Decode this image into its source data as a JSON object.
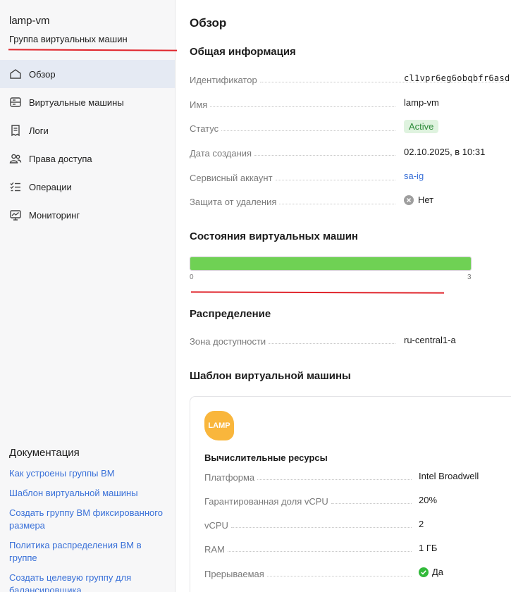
{
  "sidebar": {
    "title": "lamp-vm",
    "subtitle": "Группа виртуальных машин",
    "nav": [
      {
        "label": "Обзор",
        "icon": "overview-icon",
        "active": true
      },
      {
        "label": "Виртуальные машины",
        "icon": "vm-icon"
      },
      {
        "label": "Логи",
        "icon": "logs-icon"
      },
      {
        "label": "Права доступа",
        "icon": "users-icon"
      },
      {
        "label": "Операции",
        "icon": "operations-icon"
      },
      {
        "label": "Мониторинг",
        "icon": "monitoring-icon"
      }
    ],
    "docs": {
      "title": "Документация",
      "links": [
        "Как устроены группы ВМ",
        "Шаблон виртуальной машины",
        "Создать группу ВМ фиксированного размера",
        "Политика распределения ВМ в группе",
        "Создать целевую группу для балансировщика"
      ]
    }
  },
  "main": {
    "title": "Обзор",
    "general": {
      "title": "Общая информация",
      "id_label": "Идентификатор",
      "id_value": "cl1vpr6eg6obqbfr6asd",
      "name_label": "Имя",
      "name_value": "lamp-vm",
      "status_label": "Статус",
      "status_value": "Active",
      "created_label": "Дата создания",
      "created_value": "02.10.2025, в 10:31",
      "sa_label": "Сервисный аккаунт",
      "sa_value": "sa-ig",
      "protect_label": "Защита от удаления",
      "protect_value": "Нет"
    },
    "vm_states": {
      "title": "Состояния виртуальных машин",
      "min": "0",
      "max": "3",
      "fill_fraction": 1.0
    },
    "distribution": {
      "title": "Распределение",
      "zone_label": "Зона доступности",
      "zone_value": "ru-central1-a"
    },
    "template": {
      "title": "Шаблон виртуальной машины",
      "logo_text": "LAMP",
      "compute_title": "Вычислительные ресурсы",
      "platform_label": "Платформа",
      "platform_value": "Intel Broadwell",
      "fraction_label": "Гарантированная доля vCPU",
      "fraction_value": "20%",
      "vcpu_label": "vCPU",
      "vcpu_value": "2",
      "ram_label": "RAM",
      "ram_value": "1 ГБ",
      "preempt_label": "Прерываемая",
      "preempt_value": "Да"
    }
  },
  "colors": {
    "accent": "#3970d8",
    "active_nav": "#e5eaf3",
    "progress": "#6fd154",
    "annotation": "#e0242b"
  }
}
